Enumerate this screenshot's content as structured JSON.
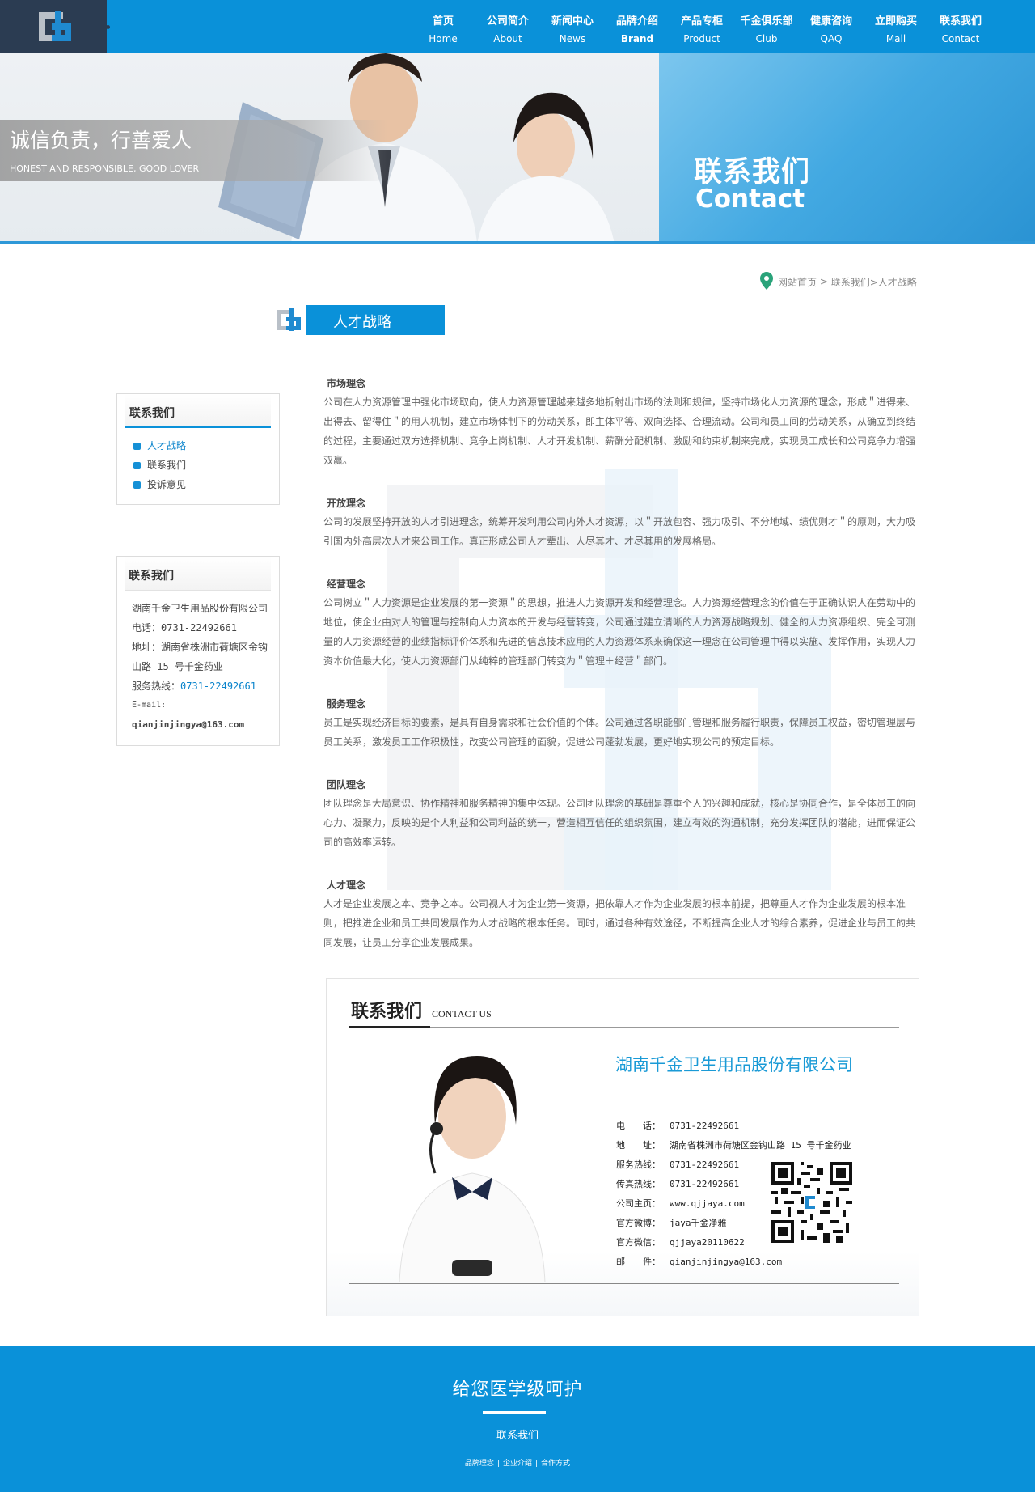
{
  "nav": [
    {
      "cn": "首页",
      "en": "Home"
    },
    {
      "cn": "公司简介",
      "en": "About"
    },
    {
      "cn": "新闻中心",
      "en": "News"
    },
    {
      "cn": "品牌介绍",
      "en": "Brand"
    },
    {
      "cn": "产品专柜",
      "en": "Product"
    },
    {
      "cn": "千金俱乐部",
      "en": "Club"
    },
    {
      "cn": "健康咨询",
      "en": "QAQ"
    },
    {
      "cn": "立即购买",
      "en": "Mall"
    },
    {
      "cn": "联系我们",
      "en": "Contact"
    }
  ],
  "banner": {
    "slogan": "诚信负责，行善爱人",
    "slogan_en": "HONEST AND RESPONSIBLE, GOOD LOVER",
    "title_cn": "联系我们",
    "title_en": "Contact"
  },
  "breadcrumb": {
    "home": "网站首页",
    "sep": " > ",
    "path": "联系我们>人才战略"
  },
  "section_title": "人才战略",
  "sidebar": {
    "nav_title": "联系我们",
    "nav_items": [
      "人才战略",
      "联系我们",
      "投诉意见"
    ],
    "contact_title": "联系我们",
    "company": "湖南千金卫生用品股份有限公司",
    "phone": "电话：0731-22492661",
    "address": "地址：湖南省株洲市荷塘区金钩山路 15 号千金药业",
    "hotline_label": "服务热线：",
    "hotline": "0731-22492661",
    "email_label": "E-mail:",
    "email": "qianjinjingya@163.com"
  },
  "article": [
    {
      "title": "市场理念",
      "text": "公司在人力资源管理中强化市场取向，使人力资源管理越来越多地折射出市场的法则和规律，坚持市场化人力资源的理念，形成＂进得来、出得去、留得住＂的用人机制，建立市场体制下的劳动关系，即主体平等、双向选择、合理流动。公司和员工间的劳动关系，从确立到终结的过程，主要通过双方选择机制、竞争上岗机制、人才开发机制、薪酬分配机制、激励和约束机制来完成，实现员工成长和公司竞争力增强双赢。"
    },
    {
      "title": "开放理念",
      "text": "公司的发展坚持开放的人才引进理念，统筹开发利用公司内外人才资源，以＂开放包容、强力吸引、不分地域、绩优则才＂的原则，大力吸引国内外高层次人才来公司工作。真正形成公司人才辈出、人尽其才、才尽其用的发展格局。"
    },
    {
      "title": "经营理念",
      "text": "公司树立＂人力资源是企业发展的第一资源＂的思想，推进人力资源开发和经营理念。人力资源经营理念的价值在于正确认识人在劳动中的地位，使企业由对人的管理与控制向人力资本的开发与经营转变，公司通过建立清晰的人力资源战略规划、健全的人力资源组织、完全可测量的人力资源经营的业绩指标评价体系和先进的信息技术应用的人力资源体系来确保这一理念在公司管理中得以实施、发挥作用，实现人力资本价值最大化，使人力资源部门从纯粹的管理部门转变为＂管理＋经营＂部门。"
    },
    {
      "title": "服务理念",
      "text": "员工是实现经济目标的要素，是具有自身需求和社会价值的个体。公司通过各职能部门管理和服务履行职责，保障员工权益，密切管理层与员工关系，激发员工工作积极性，改变公司管理的面貌，促进公司蓬勃发展，更好地实现公司的预定目标。"
    },
    {
      "title": "团队理念",
      "text": "团队理念是大局意识、协作精神和服务精神的集中体现。公司团队理念的基础是尊重个人的兴趣和成就，核心是协同合作，是全体员工的向心力、凝聚力，反映的是个人利益和公司利益的统一，营造相互信任的组织氛围，建立有效的沟通机制，充分发挥团队的潜能，进而保证公司的高效率运转。"
    },
    {
      "title": "人才理念",
      "text": "人才是企业发展之本、竞争之本。公司视人才为企业第一资源，把依靠人才作为企业发展的根本前提，把尊重人才作为企业发展的根本准则，把推进企业和员工共同发展作为人才战略的根本任务。同时，通过各种有效途径，不断提高企业人才的综合素养，促进企业与员工的共同发展，让员工分享企业发展成果。"
    }
  ],
  "contact_card": {
    "title": "联系我们",
    "title_en": "CONTACT US",
    "company": "湖南千金卫生用品股份有限公司",
    "rows": [
      {
        "label": "电　　话：",
        "value": "0731-22492661"
      },
      {
        "label": "地　　址：",
        "value": "湖南省株洲市荷塘区金钩山路 15 号千金药业"
      },
      {
        "label": "服务热线：",
        "value": "0731-22492661"
      },
      {
        "label": "传真热线：",
        "value": "0731-22492661"
      },
      {
        "label": "公司主页：",
        "value": "www.qjjaya.com"
      },
      {
        "label": "官方微博：",
        "value": "jaya千金净雅"
      },
      {
        "label": "官方微信：",
        "value": "qjjaya20110622"
      },
      {
        "label": "邮　　件：",
        "value": "qianjinjingya@163.com"
      }
    ]
  },
  "footer": {
    "slogan": "给您医学级呵护",
    "contact": "联系我们",
    "links": [
      "品牌理念",
      "企业介绍",
      "合作方式"
    ]
  },
  "colors": {
    "primary": "#0a91d9",
    "dark": "#2b3c52",
    "link": "#0a84cc"
  }
}
